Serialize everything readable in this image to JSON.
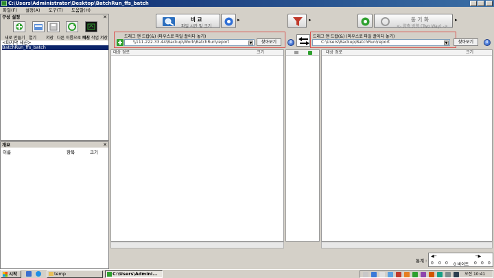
{
  "window": {
    "title": "C:\\Users\\Administrator\\Desktop\\BatchRun_ffs_batch"
  },
  "menu": [
    "파일(F)",
    "설정(A)",
    "도구(T)",
    "도움말(H)"
  ],
  "config": {
    "header": "구성 설정",
    "close": "✕",
    "toolbar": [
      "새로 만들기",
      "열기",
      "저장",
      "다른 이름으로 저장",
      "배치 작업 저장"
    ],
    "items": [
      "<마지막 세션>",
      "BatchRun_ffs_batch"
    ]
  },
  "overview": {
    "header": "개요",
    "close": "✕",
    "columns": [
      "이름",
      "항목",
      "크기"
    ]
  },
  "compare": {
    "title": "비 교",
    "subtitle": "파일 시간 및 크기"
  },
  "sync": {
    "title": "동 기 화",
    "subtitle": "<- 양측 방향 (Two Way) ->"
  },
  "left": {
    "drop_label": "드래그 앤 드랍(&) (마우스로 파일 끌어다 놓기)",
    "path": "\\\\111.222.33.44\\Backup\\Work\\BatchRun\\report",
    "browse": "찾아보기",
    "col_path": "대상 경로",
    "col_size": "크기"
  },
  "right": {
    "drop_label": "드래그 앤 드랍(&) (마우스로 파일 끌어다 놓기)",
    "path": "C:\\Users\\Backup\\BatchRun\\report",
    "browse": "찾아보기",
    "col_path": "대상 경로",
    "col_size": "크기"
  },
  "status": {
    "label": "통계 :",
    "counts": [
      "0",
      "0",
      "0",
      "0",
      "0",
      "0"
    ],
    "unit": "0 바이트"
  },
  "taskbar": {
    "start": "시작",
    "items": [
      "temp",
      "C:\\Users\\Admini..."
    ],
    "clock": "오전 10:41"
  },
  "colors": {
    "titlebar": "#0a246a",
    "accent_red": "#d9534f",
    "filter_red": "#c0392b",
    "gear_blue": "#2f6fd6"
  }
}
